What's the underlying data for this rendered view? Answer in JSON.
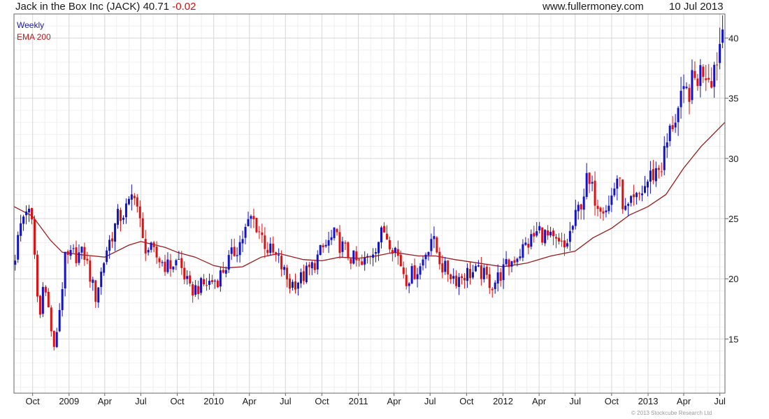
{
  "header": {
    "title": "Jack in the Box Inc (JACK) 40.71",
    "change": "-0.02",
    "site": "www.fullermoney.com",
    "date": "10 Jul 2013"
  },
  "legend": {
    "weekly": "Weekly",
    "ema": "EMA 200"
  },
  "copyright": "© 2013 Stockcube Research Ltd",
  "colors": {
    "up": "#1212cc",
    "down": "#dd1111",
    "ema": "#9b1b1b",
    "grid": "#d9d9d9",
    "frame": "#666666"
  },
  "chart_data": {
    "type": "candlestick",
    "title": "Jack in the Box Inc (JACK) 40.71 -0.02",
    "frequency": "Weekly",
    "y_axis_side": "right",
    "ylim": [
      10.5,
      42
    ],
    "yticks": [
      15,
      20,
      25,
      30,
      35,
      40
    ],
    "x_range": [
      "2008-08-15",
      "2013-07-14"
    ],
    "xticks": [
      {
        "date": "2008-10-01",
        "label": "Oct"
      },
      {
        "date": "2009-01-01",
        "label": "2009"
      },
      {
        "date": "2009-04-01",
        "label": "Apr"
      },
      {
        "date": "2009-07-01",
        "label": "Jul"
      },
      {
        "date": "2009-10-01",
        "label": "Oct"
      },
      {
        "date": "2010-01-01",
        "label": "2010"
      },
      {
        "date": "2010-04-01",
        "label": "Apr"
      },
      {
        "date": "2010-07-01",
        "label": "Jul"
      },
      {
        "date": "2010-10-01",
        "label": "Oct"
      },
      {
        "date": "2011-01-01",
        "label": "2011"
      },
      {
        "date": "2011-04-01",
        "label": "Apr"
      },
      {
        "date": "2011-07-01",
        "label": "Jul"
      },
      {
        "date": "2011-10-01",
        "label": "Oct"
      },
      {
        "date": "2012-01-01",
        "label": "2012"
      },
      {
        "date": "2012-04-01",
        "label": "Apr"
      },
      {
        "date": "2012-07-01",
        "label": "Jul"
      },
      {
        "date": "2012-10-01",
        "label": "Oct"
      },
      {
        "date": "2013-01-01",
        "label": "2013"
      },
      {
        "date": "2013-04-01",
        "label": "Apr"
      },
      {
        "date": "2013-07-01",
        "label": "Jul"
      }
    ],
    "grid": true,
    "series": [
      {
        "name": "Weekly",
        "kind": "close",
        "points": [
          [
            "2008-08-18",
            22.0
          ],
          [
            "2008-09-01",
            24.5
          ],
          [
            "2008-09-15",
            26.0
          ],
          [
            "2008-09-29",
            24.5
          ],
          [
            "2008-10-06",
            22.0
          ],
          [
            "2008-10-13",
            18.5
          ],
          [
            "2008-10-20",
            17.0
          ],
          [
            "2008-10-27",
            20.0
          ],
          [
            "2008-11-10",
            17.5
          ],
          [
            "2008-11-24",
            14.0
          ],
          [
            "2008-12-08",
            17.5
          ],
          [
            "2008-12-22",
            21.5
          ],
          [
            "2009-01-12",
            22.0
          ],
          [
            "2009-02-09",
            22.0
          ],
          [
            "2009-03-09",
            18.5
          ],
          [
            "2009-04-06",
            22.5
          ],
          [
            "2009-05-04",
            25.0
          ],
          [
            "2009-06-01",
            26.0
          ],
          [
            "2009-06-15",
            27.5
          ],
          [
            "2009-07-06",
            23.0
          ],
          [
            "2009-08-03",
            22.0
          ],
          [
            "2009-09-07",
            21.0
          ],
          [
            "2009-10-05",
            21.5
          ],
          [
            "2009-11-02",
            19.0
          ],
          [
            "2009-12-07",
            19.5
          ],
          [
            "2010-01-11",
            20.0
          ],
          [
            "2010-02-08",
            21.5
          ],
          [
            "2010-03-08",
            23.0
          ],
          [
            "2010-04-05",
            25.0
          ],
          [
            "2010-04-19",
            24.5
          ],
          [
            "2010-05-17",
            22.5
          ],
          [
            "2010-06-14",
            21.5
          ],
          [
            "2010-07-12",
            19.5
          ],
          [
            "2010-08-09",
            20.0
          ],
          [
            "2010-09-06",
            21.0
          ],
          [
            "2010-10-04",
            22.5
          ],
          [
            "2010-11-01",
            23.5
          ],
          [
            "2010-12-06",
            22.0
          ],
          [
            "2011-01-10",
            21.0
          ],
          [
            "2011-02-07",
            22.5
          ],
          [
            "2011-03-07",
            24.0
          ],
          [
            "2011-04-04",
            22.5
          ],
          [
            "2011-05-02",
            20.0
          ],
          [
            "2011-06-06",
            21.0
          ],
          [
            "2011-07-04",
            23.5
          ],
          [
            "2011-08-01",
            21.0
          ],
          [
            "2011-09-05",
            20.0
          ],
          [
            "2011-10-03",
            20.5
          ],
          [
            "2011-11-07",
            20.5
          ],
          [
            "2011-12-05",
            19.5
          ],
          [
            "2012-01-09",
            21.0
          ],
          [
            "2012-02-06",
            22.0
          ],
          [
            "2012-03-05",
            23.0
          ],
          [
            "2012-04-02",
            24.0
          ],
          [
            "2012-05-07",
            23.0
          ],
          [
            "2012-06-04",
            22.5
          ],
          [
            "2012-07-02",
            25.0
          ],
          [
            "2012-07-30",
            28.0
          ],
          [
            "2012-08-27",
            26.5
          ],
          [
            "2012-09-24",
            26.0
          ],
          [
            "2012-10-15",
            28.5
          ],
          [
            "2012-11-05",
            25.5
          ],
          [
            "2012-12-03",
            26.5
          ],
          [
            "2013-01-07",
            28.5
          ],
          [
            "2013-02-04",
            29.5
          ],
          [
            "2013-03-04",
            33.0
          ],
          [
            "2013-04-01",
            35.0
          ],
          [
            "2013-04-29",
            36.5
          ],
          [
            "2013-05-20",
            37.5
          ],
          [
            "2013-06-10",
            37.0
          ],
          [
            "2013-06-24",
            38.5
          ],
          [
            "2013-07-08",
            40.71
          ]
        ]
      },
      {
        "name": "EMA 200",
        "kind": "line",
        "points": [
          [
            "2008-08-15",
            26.0
          ],
          [
            "2008-10-01",
            25.2
          ],
          [
            "2008-11-15",
            23.2
          ],
          [
            "2008-12-15",
            22.2
          ],
          [
            "2009-02-01",
            22.0
          ],
          [
            "2009-04-01",
            21.8
          ],
          [
            "2009-06-01",
            22.8
          ],
          [
            "2009-07-01",
            23.1
          ],
          [
            "2009-09-01",
            22.6
          ],
          [
            "2009-10-01",
            22.2
          ],
          [
            "2009-11-15",
            21.8
          ],
          [
            "2010-01-01",
            21.1
          ],
          [
            "2010-02-01",
            20.9
          ],
          [
            "2010-03-15",
            21.0
          ],
          [
            "2010-05-01",
            21.8
          ],
          [
            "2010-06-15",
            22.1
          ],
          [
            "2010-08-15",
            21.6
          ],
          [
            "2010-10-01",
            21.5
          ],
          [
            "2010-11-15",
            21.8
          ],
          [
            "2011-01-01",
            21.7
          ],
          [
            "2011-02-15",
            21.9
          ],
          [
            "2011-04-01",
            22.2
          ],
          [
            "2011-06-01",
            21.9
          ],
          [
            "2011-07-15",
            21.9
          ],
          [
            "2011-09-01",
            21.6
          ],
          [
            "2011-11-01",
            21.3
          ],
          [
            "2012-01-01",
            21.0
          ],
          [
            "2012-03-01",
            21.3
          ],
          [
            "2012-05-01",
            21.9
          ],
          [
            "2012-07-01",
            22.3
          ],
          [
            "2012-08-15",
            23.4
          ],
          [
            "2012-10-01",
            24.2
          ],
          [
            "2012-11-15",
            25.3
          ],
          [
            "2013-01-01",
            26.0
          ],
          [
            "2013-02-15",
            27.0
          ],
          [
            "2013-04-01",
            29.2
          ],
          [
            "2013-05-15",
            31.0
          ],
          [
            "2013-07-14",
            33.0
          ]
        ]
      }
    ]
  }
}
